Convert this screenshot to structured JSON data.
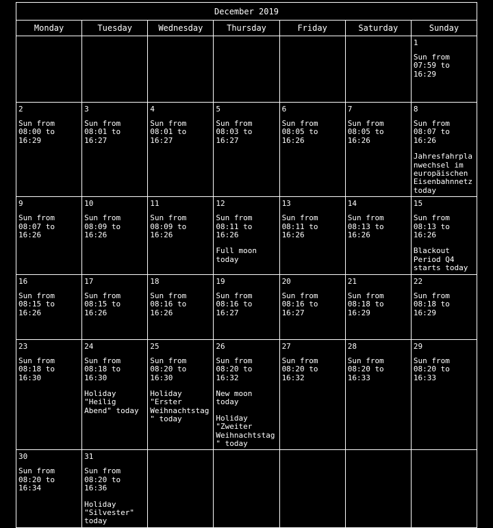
{
  "calendar": {
    "title": "December 2019",
    "weekday_headers": [
      "Monday",
      "Tuesday",
      "Wednesday",
      "Thursday",
      "Friday",
      "Saturday",
      "Sunday"
    ],
    "colors": {
      "background": "#000000",
      "text": "#ffffff",
      "border": "#ffffff"
    },
    "weeks": [
      [
        {
          "day": "",
          "events": []
        },
        {
          "day": "",
          "events": []
        },
        {
          "day": "",
          "events": []
        },
        {
          "day": "",
          "events": []
        },
        {
          "day": "",
          "events": []
        },
        {
          "day": "",
          "events": []
        },
        {
          "day": "1",
          "events": [
            "Sun from 07:59 to 16:29"
          ]
        }
      ],
      [
        {
          "day": "2",
          "events": [
            "Sun from 08:00 to 16:29"
          ]
        },
        {
          "day": "3",
          "events": [
            "Sun from 08:01 to 16:27"
          ]
        },
        {
          "day": "4",
          "events": [
            "Sun from 08:01 to 16:27"
          ]
        },
        {
          "day": "5",
          "events": [
            "Sun from 08:03 to 16:27"
          ]
        },
        {
          "day": "6",
          "events": [
            "Sun from 08:05 to 16:26"
          ]
        },
        {
          "day": "7",
          "events": [
            "Sun from 08:05 to 16:26"
          ]
        },
        {
          "day": "8",
          "events": [
            "Sun from 08:07 to 16:26",
            "Jahresfahrplanwechsel im europäischen Eisenbahnnetz today"
          ]
        }
      ],
      [
        {
          "day": "9",
          "events": [
            "Sun from 08:07 to 16:26"
          ]
        },
        {
          "day": "10",
          "events": [
            "Sun from 08:09 to 16:26"
          ]
        },
        {
          "day": "11",
          "events": [
            "Sun from 08:09 to 16:26"
          ]
        },
        {
          "day": "12",
          "events": [
            "Sun from 08:11 to 16:26",
            "Full moon today"
          ]
        },
        {
          "day": "13",
          "events": [
            "Sun from 08:11 to 16:26"
          ]
        },
        {
          "day": "14",
          "events": [
            "Sun from 08:13 to 16:26"
          ]
        },
        {
          "day": "15",
          "events": [
            "Sun from 08:13 to 16:26",
            "Blackout Period Q4 starts today"
          ]
        }
      ],
      [
        {
          "day": "16",
          "events": [
            "Sun from 08:15 to 16:26"
          ]
        },
        {
          "day": "17",
          "events": [
            "Sun from 08:15 to 16:26"
          ]
        },
        {
          "day": "18",
          "events": [
            "Sun from 08:16 to 16:26"
          ]
        },
        {
          "day": "19",
          "events": [
            "Sun from 08:16 to 16:27"
          ]
        },
        {
          "day": "20",
          "events": [
            "Sun from 08:16 to 16:27"
          ]
        },
        {
          "day": "21",
          "events": [
            "Sun from 08:18 to 16:29"
          ]
        },
        {
          "day": "22",
          "events": [
            "Sun from 08:18 to 16:29"
          ]
        }
      ],
      [
        {
          "day": "23",
          "events": [
            "Sun from 08:18 to 16:30"
          ]
        },
        {
          "day": "24",
          "events": [
            "Sun from 08:18 to 16:30",
            "Holiday \"Heilig Abend\" today"
          ]
        },
        {
          "day": "25",
          "events": [
            "Sun from 08:20 to 16:30",
            "Holiday \"Erster Weihnachtstag\" today"
          ]
        },
        {
          "day": "26",
          "events": [
            "Sun from 08:20 to 16:32",
            "New moon today",
            "Holiday \"Zweiter Weihnachtstag\" today"
          ]
        },
        {
          "day": "27",
          "events": [
            "Sun from 08:20 to 16:32"
          ]
        },
        {
          "day": "28",
          "events": [
            "Sun from 08:20 to 16:33"
          ]
        },
        {
          "day": "29",
          "events": [
            "Sun from 08:20 to 16:33"
          ]
        }
      ],
      [
        {
          "day": "30",
          "events": [
            "Sun from 08:20 to 16:34"
          ]
        },
        {
          "day": "31",
          "events": [
            "Sun from 08:20 to 16:36",
            "Holiday \"Silvester\" today"
          ]
        },
        {
          "day": "",
          "events": []
        },
        {
          "day": "",
          "events": []
        },
        {
          "day": "",
          "events": []
        },
        {
          "day": "",
          "events": []
        },
        {
          "day": "",
          "events": []
        }
      ]
    ]
  }
}
